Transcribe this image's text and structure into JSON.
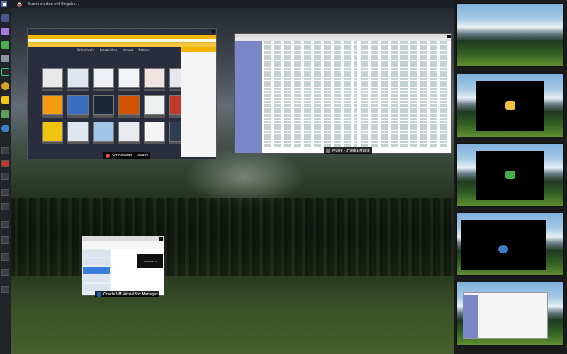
{
  "topbar": {
    "search_placeholder": "Suche starten mit Eingabe..."
  },
  "windows": {
    "vivaldi": {
      "title": "Schnellwahl - Vivaldi",
      "speed_dial_nav": [
        "Schnellwahl",
        "Lesezeichen",
        "Verlauf",
        "Notizen"
      ]
    },
    "music": {
      "title": "Musik - /media/Musik"
    },
    "virtualbox": {
      "title": "Oracle VM VirtualBox Manager",
      "preview_label": "Windows 10"
    }
  },
  "workspaces": {
    "count": 5
  },
  "colors": {
    "vivaldi_accent": "#f4b400",
    "music_sidebar": "#7a86c8",
    "vbox_selected": "#3c7ddb",
    "dock_bg": "#202327"
  }
}
